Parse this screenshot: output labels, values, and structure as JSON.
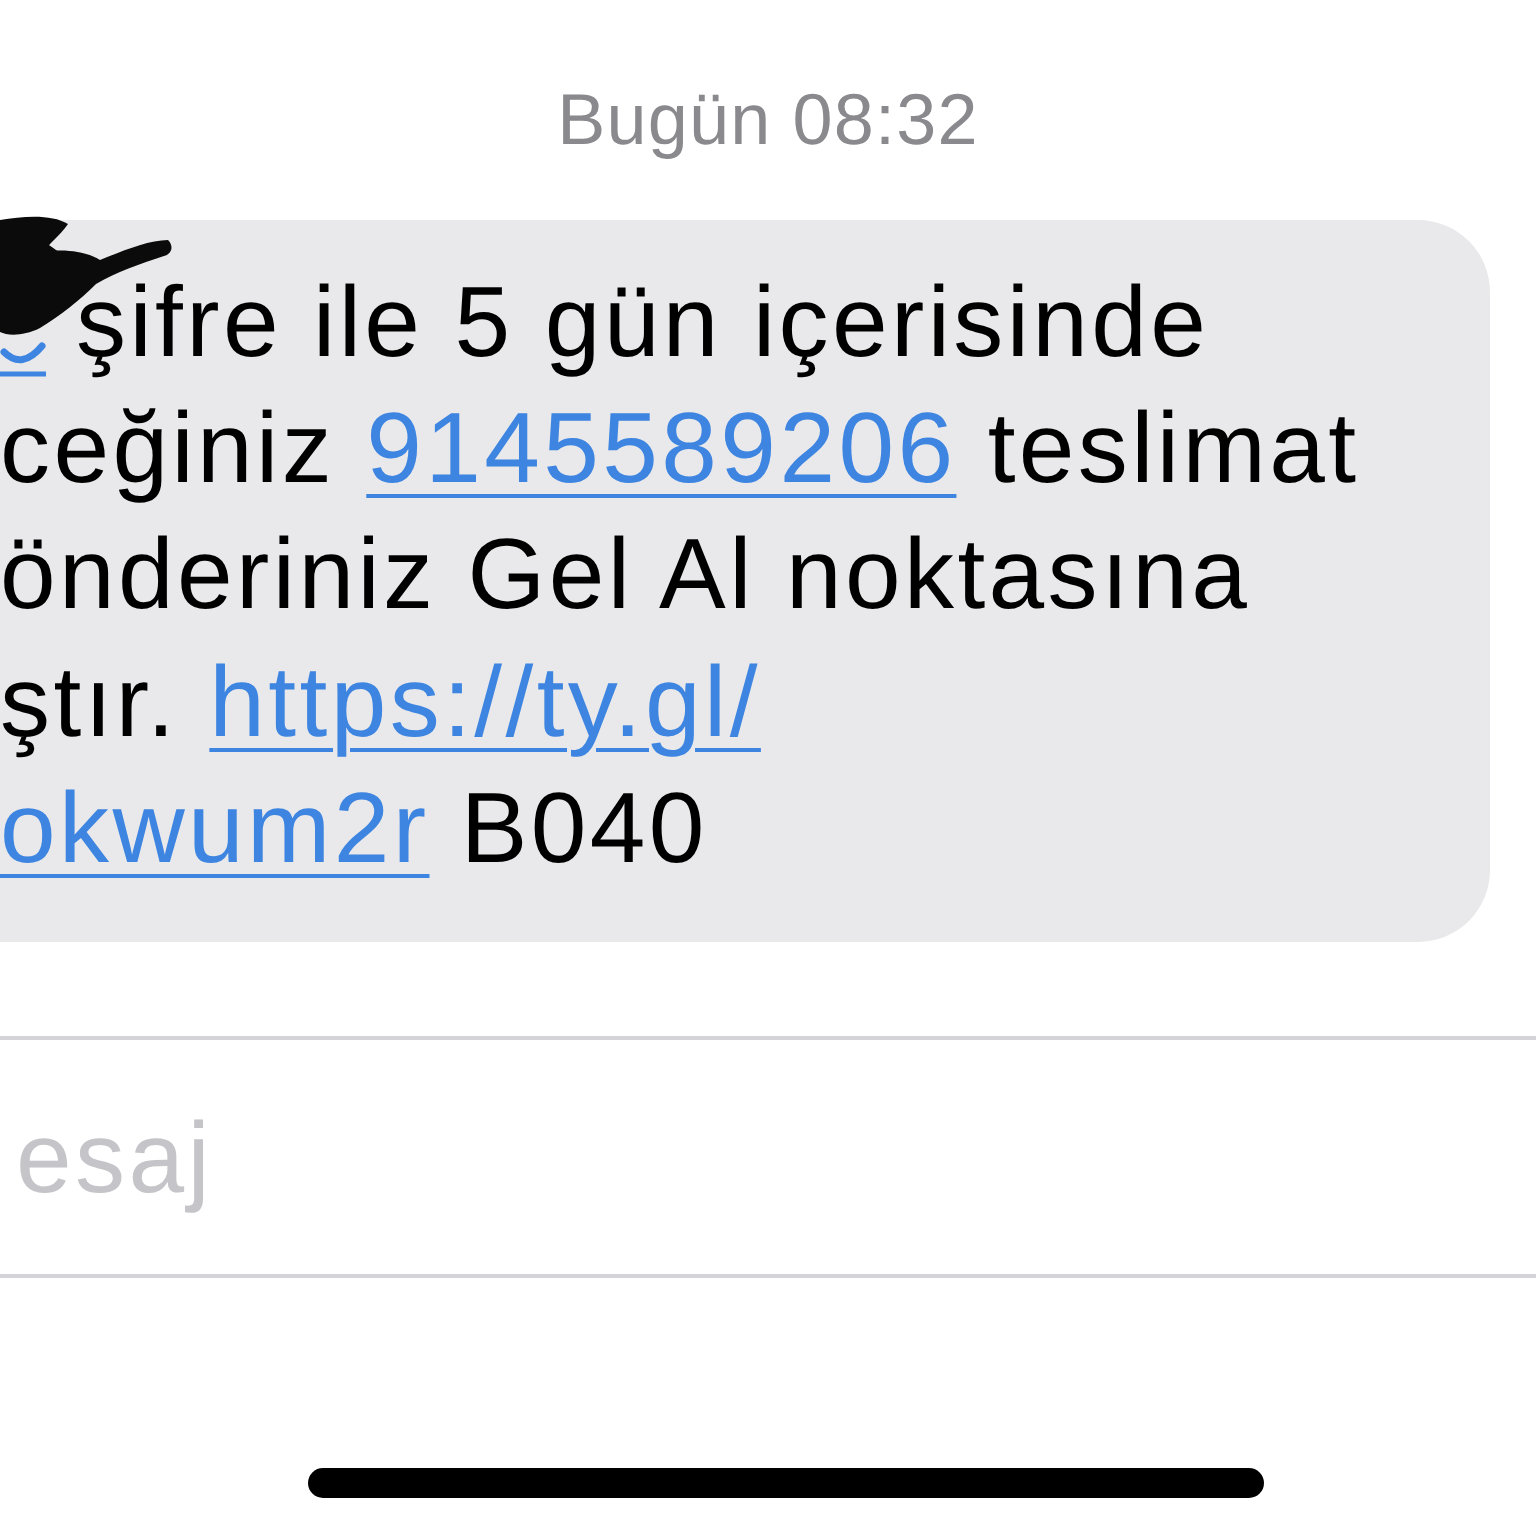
{
  "timestamp": "Bugün 08:32",
  "messages": [
    {
      "lines": [
        [
          {
            "kind": "redacted"
          },
          {
            "kind": "text",
            "text": "şifre ile 5 gün içerisinde"
          }
        ],
        [
          {
            "kind": "text",
            "text": "ceğiniz"
          },
          {
            "kind": "link",
            "text": "9145589206"
          },
          {
            "kind": "text",
            "text": "teslimat"
          }
        ],
        [
          {
            "kind": "text",
            "text": "önderiniz Gel Al noktasına"
          }
        ],
        [
          {
            "kind": "text",
            "text": "ştır."
          },
          {
            "kind": "link",
            "text": "https://ty.gl/"
          }
        ],
        [
          {
            "kind": "link",
            "text": "okwum2r"
          },
          {
            "kind": "text",
            "text": "B040"
          }
        ]
      ]
    }
  ],
  "composer": {
    "placeholder": "esaj"
  }
}
